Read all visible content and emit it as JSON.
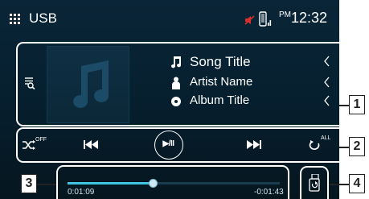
{
  "header": {
    "title": "USB",
    "ampm": "PM",
    "time": "12:32",
    "icons": [
      "grid-menu-icon",
      "mute-icon",
      "phone-icon"
    ]
  },
  "track": {
    "song_title": "Song Title",
    "artist_name": "Artist Name",
    "album_title": "Album Title",
    "album_art_icon": "music-note-icon"
  },
  "controls": {
    "shuffle_state": "OFF",
    "repeat_state": "ALL",
    "play_pause_label": "▶/II",
    "icons": [
      "list-search-icon",
      "shuffle-icon",
      "previous-track-icon",
      "play-pause-icon",
      "next-track-icon",
      "repeat-icon",
      "usb-device-icon"
    ]
  },
  "progress": {
    "elapsed": "0:01:09",
    "remaining": "-0:01:43",
    "fraction": 0.4
  },
  "callouts": {
    "c1": "1",
    "c2": "2",
    "c3": "3",
    "c4": "4"
  },
  "colors": {
    "background": "#062030",
    "accent": "#3fc4e4",
    "text": "#ffffff",
    "mute_red": "#d9302c"
  }
}
